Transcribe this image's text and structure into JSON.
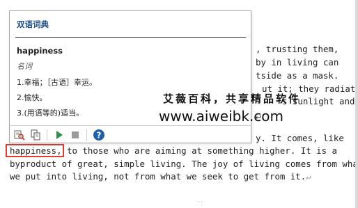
{
  "document": {
    "right_fragments": [
      ", trusting them,",
      "by in living can",
      "tside as a mask.",
      "ut it; they radiate",
      "s sunlight and"
    ],
    "line_fragment_6": "y. It comes, like",
    "line_7_highlight": "happiness,",
    "line_7_rest": " to those who are aiming at something higher. It is a",
    "line_8": "byproduct of great, simple living. The joy of living comes from what",
    "line_9": "we put into living, not from what we seek to get from it.",
    "pilcrow": "↵",
    "bottom_marks": "· ·"
  },
  "popup": {
    "title": "双语词典",
    "headword": "happiness",
    "part_of_speech": "名词",
    "definitions": [
      "1.幸福；［古语］幸运。",
      "2.愉快。",
      "3.(用语等的)适当。"
    ],
    "toolbar": {
      "icons": [
        "dictionary-search-icon",
        "copy-icon",
        "play-icon",
        "stop-icon",
        "help-icon"
      ],
      "accent_color": "#2f8f4f",
      "help_color": "#1f5fa8"
    }
  },
  "watermark": {
    "cn_text": "艾薇百科，共享精品软件",
    "url_text": "www.aiweibk.com"
  }
}
